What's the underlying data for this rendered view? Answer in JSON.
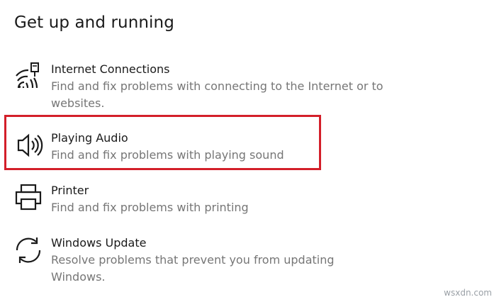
{
  "section": {
    "title": "Get up and running"
  },
  "items": [
    {
      "label": "Internet Connections",
      "description": "Find and fix problems with connecting to the Internet or to websites.",
      "icon": "wifi-network-icon"
    },
    {
      "label": "Playing Audio",
      "description": "Find and fix problems with playing sound",
      "icon": "speaker-icon",
      "highlighted": true
    },
    {
      "label": "Printer",
      "description": "Find and fix problems with printing",
      "icon": "printer-icon"
    },
    {
      "label": "Windows Update",
      "description": "Resolve problems that prevent you from updating Windows.",
      "icon": "refresh-icon"
    }
  ],
  "watermark": "wsxdn.com",
  "colors": {
    "highlight": "#d31f2a",
    "title_text": "#1a1a1a",
    "description_text": "#767676"
  }
}
